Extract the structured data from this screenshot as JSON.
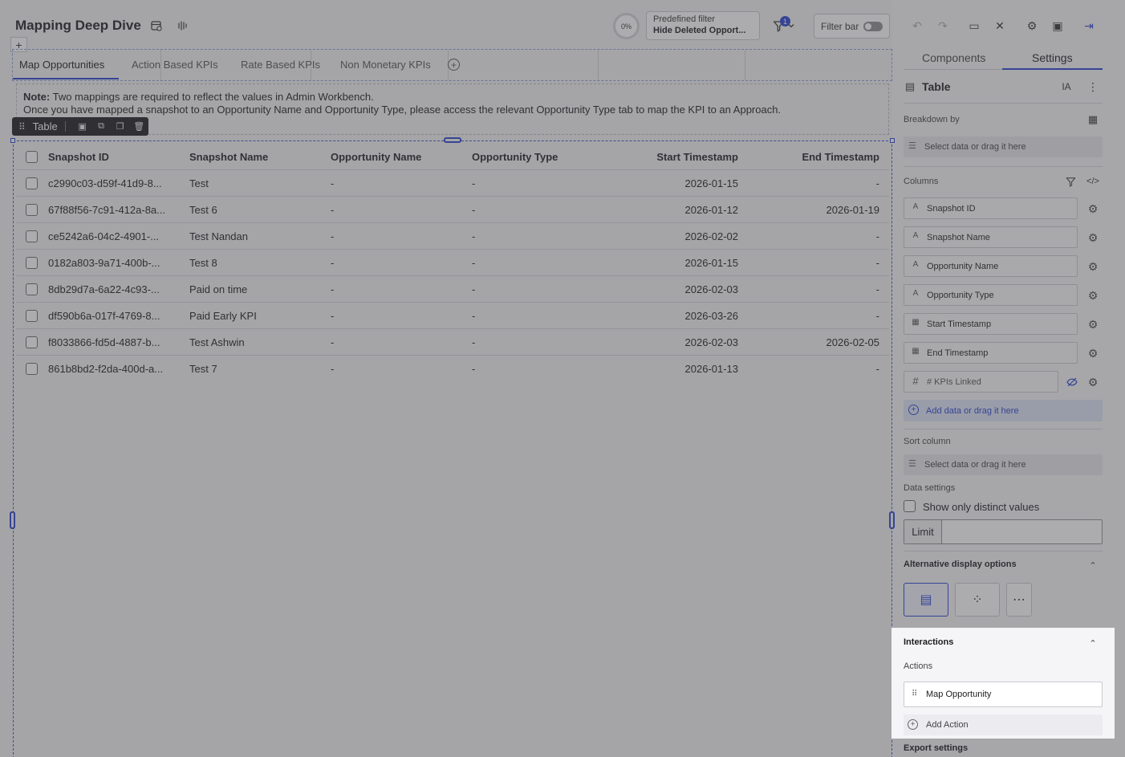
{
  "header": {
    "title": "Mapping Deep Dive",
    "progress": "0%",
    "predefined_filter_label": "Predefined filter",
    "predefined_filter_value": "Hide Deleted Opport...",
    "filter_badge": "1",
    "filter_bar_label": "Filter bar"
  },
  "tabs": [
    "Map Opportunities",
    "Action Based KPIs",
    "Rate Based KPIs",
    "Non Monetary KPIs"
  ],
  "note": {
    "bold": "Note:",
    "line1": " Two mappings are required to reflect the values in Admin Workbench.",
    "line2": "Once you have mapped a snapshot to an Opportunity Name and Opportunity Type, please access the relevant Opportunity Type tab to map the KPI to an Approach."
  },
  "element_toolbar": {
    "label": "Table"
  },
  "table": {
    "columns": [
      "Snapshot ID",
      "Snapshot Name",
      "Opportunity Name",
      "Opportunity Type",
      "Start Timestamp",
      "End Timestamp"
    ],
    "rows": [
      [
        "c2990c03-d59f-41d9-8...",
        "Test",
        "-",
        "-",
        "2026-01-15",
        "-"
      ],
      [
        "67f88f56-7c91-412a-8a...",
        "Test 6",
        "-",
        "-",
        "2026-01-12",
        "2026-01-19"
      ],
      [
        "ce5242a6-04c2-4901-...",
        "Test Nandan",
        "-",
        "-",
        "2026-02-02",
        "-"
      ],
      [
        "0182a803-9a71-400b-...",
        "Test 8",
        "-",
        "-",
        "2026-01-15",
        "-"
      ],
      [
        "8db29d7a-6a22-4c93-...",
        "Paid on time",
        "-",
        "-",
        "2026-02-03",
        "-"
      ],
      [
        "df590b6a-017f-4769-8...",
        "Paid Early KPI",
        "-",
        "-",
        "2026-03-26",
        "-"
      ],
      [
        "f8033866-fd5d-4887-b...",
        "Test Ashwin",
        "-",
        "-",
        "2026-02-03",
        "2026-02-05"
      ],
      [
        "861b8bd2-f2da-400d-a...",
        "Test 7",
        "-",
        "-",
        "2026-01-13",
        "-"
      ]
    ]
  },
  "panel": {
    "tabs": [
      "Components",
      "Settings"
    ],
    "element_type": "Table",
    "breakdown_label": "Breakdown by",
    "drop_placeholder": "Select data or drag it here",
    "columns_label": "Columns",
    "columns": [
      {
        "type": "A",
        "label": "Snapshot ID"
      },
      {
        "type": "A",
        "label": "Snapshot Name"
      },
      {
        "type": "A",
        "label": "Opportunity Name"
      },
      {
        "type": "A",
        "label": "Opportunity Type"
      },
      {
        "type": "cal",
        "label": "Start Timestamp"
      },
      {
        "type": "cal",
        "label": "End Timestamp"
      },
      {
        "type": "#",
        "label": "# KPIs Linked"
      }
    ],
    "add_data_label": "Add data or drag it here",
    "sort_label": "Sort column",
    "data_settings_label": "Data settings",
    "distinct_label": "Show only distinct values",
    "limit_label": "Limit",
    "alt_display_label": "Alternative display options",
    "interactions_label": "Interactions",
    "actions_label": "Actions",
    "action_item": "Map Opportunity",
    "add_action_label": "Add Action",
    "export_label": "Export settings"
  }
}
